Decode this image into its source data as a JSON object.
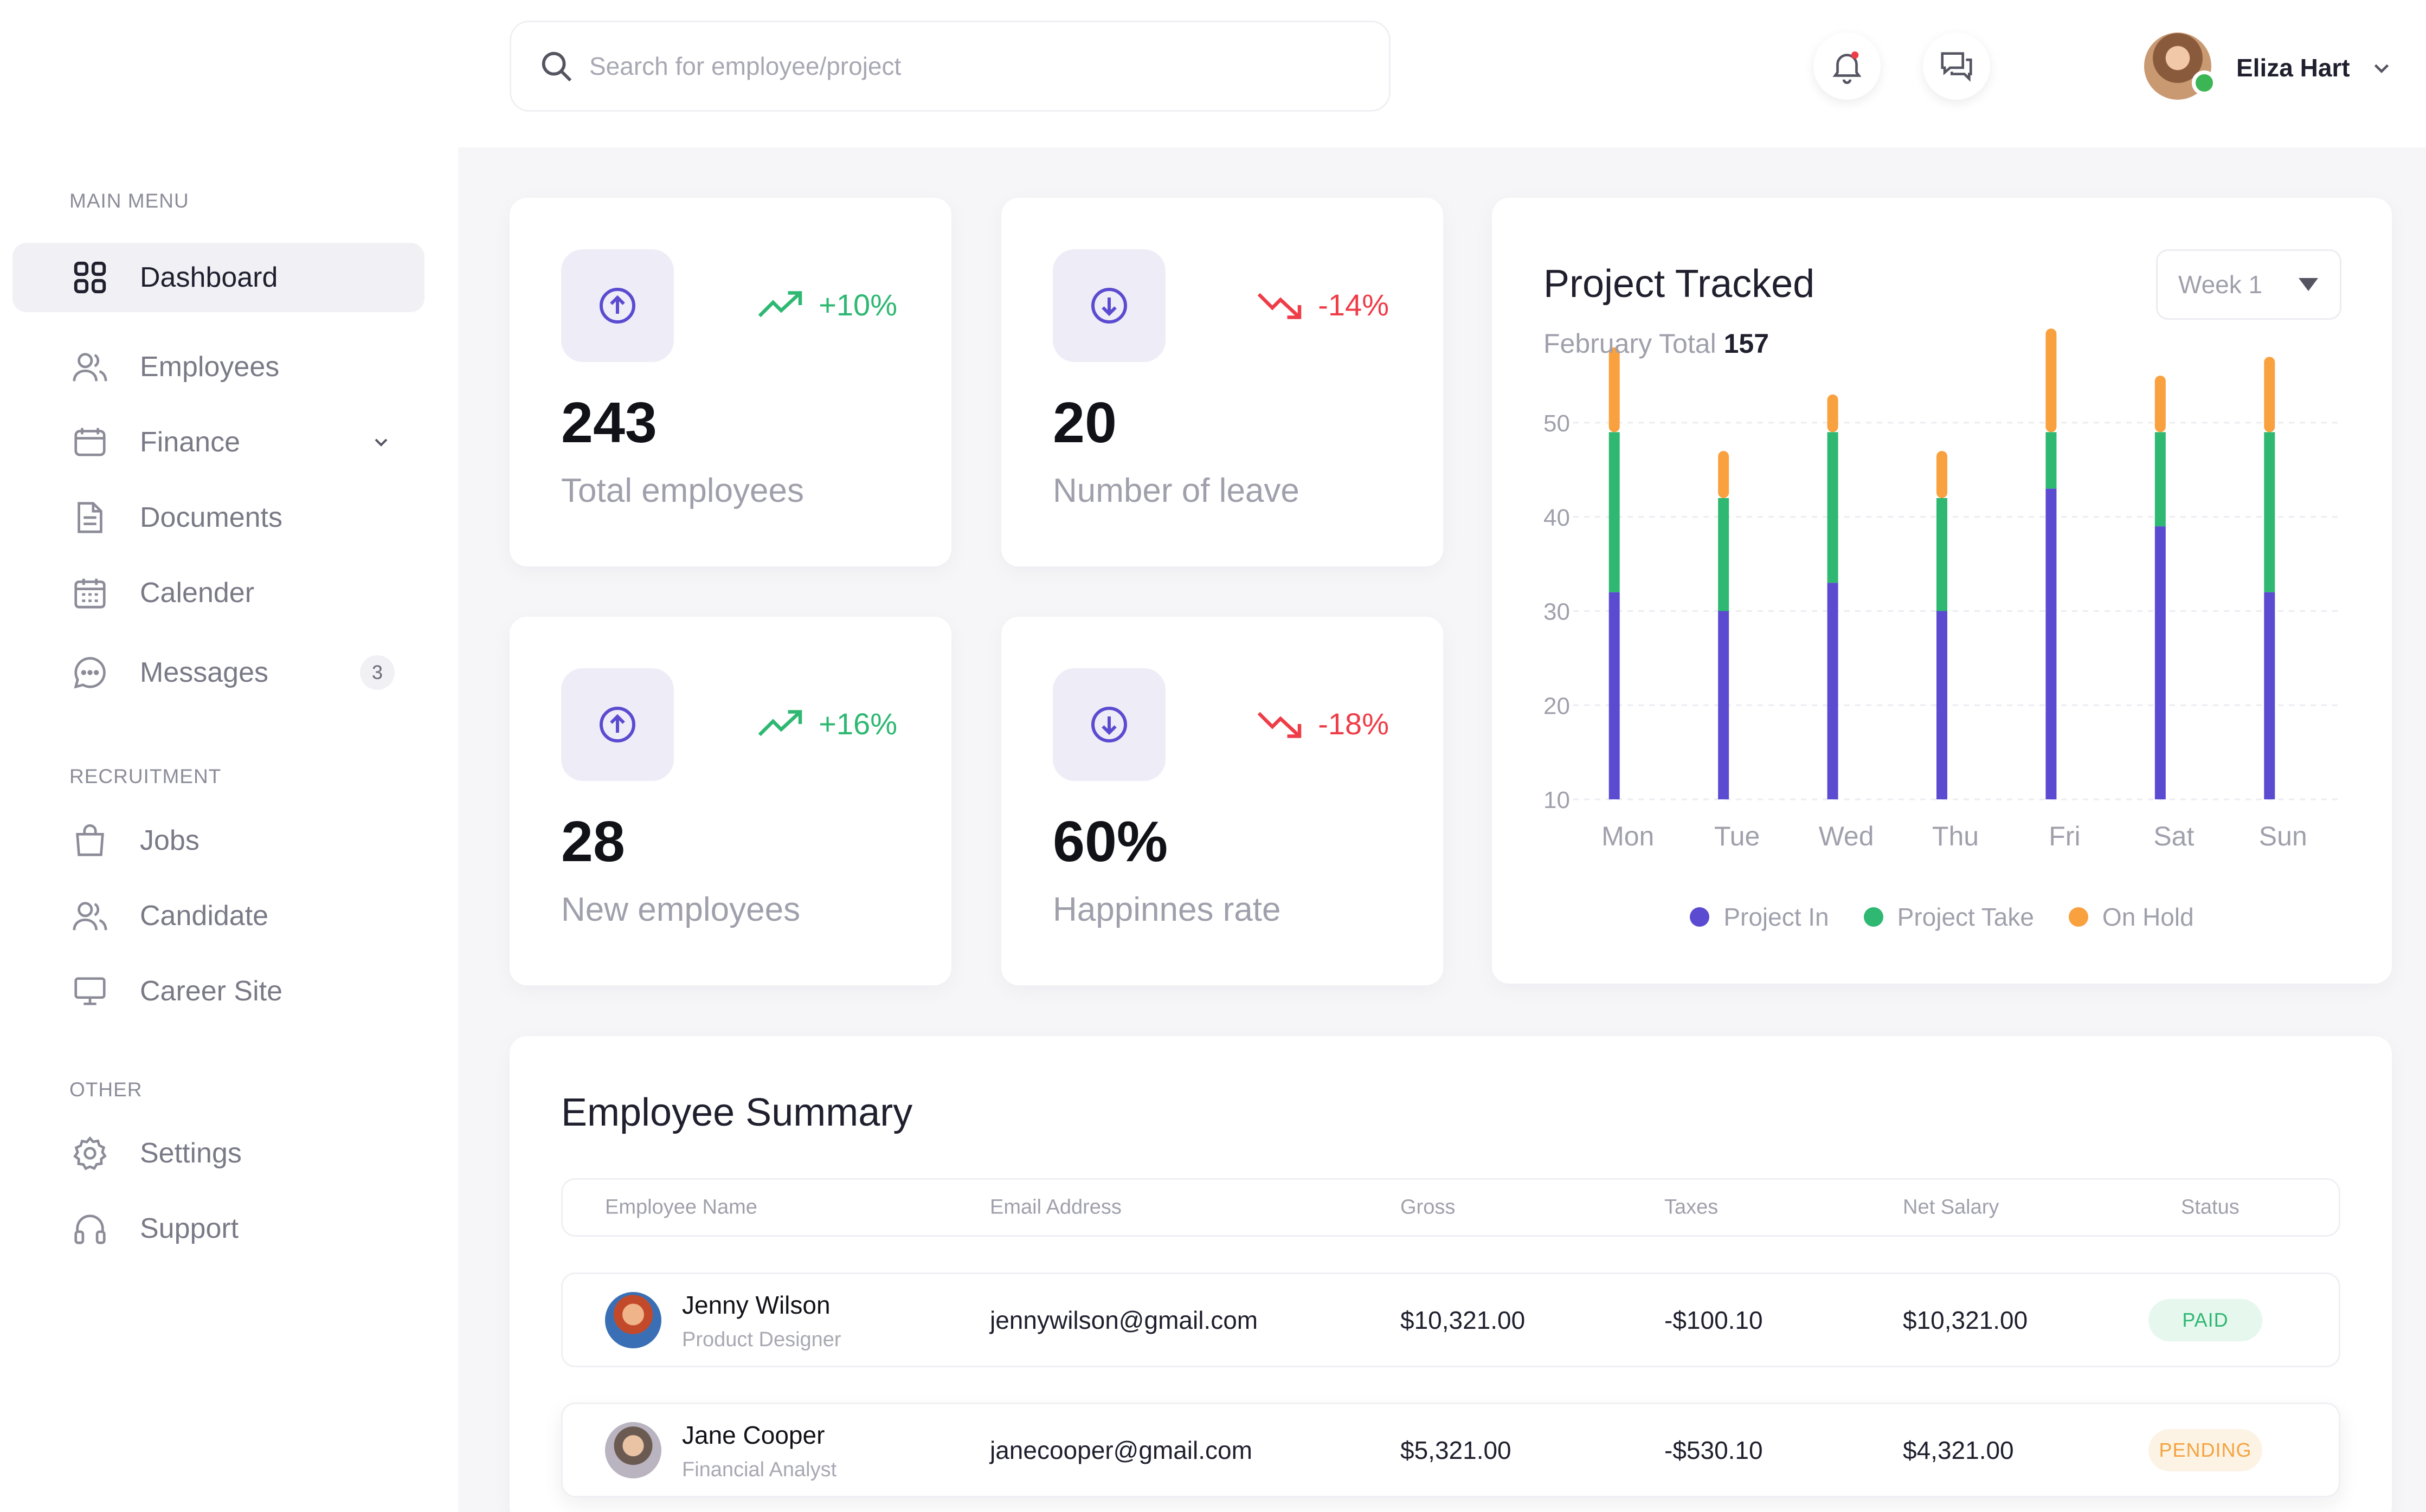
{
  "search": {
    "placeholder": "Search for employee/project"
  },
  "user": {
    "name": "Eliza Hart"
  },
  "sidebar": {
    "sections": {
      "main": "MAIN MENU",
      "recruitment": "RECRUITMENT",
      "other": "OTHER"
    },
    "items": [
      {
        "label": "Dashboard",
        "icon": "grid-icon",
        "active": true
      },
      {
        "label": "Employees",
        "icon": "users-icon"
      },
      {
        "label": "Finance",
        "icon": "wallet-icon",
        "has_chevron": true
      },
      {
        "label": "Documents",
        "icon": "document-icon"
      },
      {
        "label": "Calender",
        "icon": "calendar-icon"
      },
      {
        "label": "Messages",
        "icon": "chat-icon",
        "badge": "3"
      },
      {
        "label": "Jobs",
        "icon": "bag-icon"
      },
      {
        "label": "Candidate",
        "icon": "users-icon"
      },
      {
        "label": "Career Site",
        "icon": "monitor-icon"
      },
      {
        "label": "Settings",
        "icon": "gear-icon"
      },
      {
        "label": "Support",
        "icon": "headset-icon"
      }
    ]
  },
  "stats": [
    {
      "value": "243",
      "label": "Total employees",
      "trend": "+10%",
      "direction": "up"
    },
    {
      "value": "20",
      "label": "Number of leave",
      "trend": "-14%",
      "direction": "down"
    },
    {
      "value": "28",
      "label": "New employees",
      "trend": "+16%",
      "direction": "up"
    },
    {
      "value": "60%",
      "label": "Happinnes rate",
      "trend": "-18%",
      "direction": "down"
    }
  ],
  "project_chart": {
    "title": "Project Tracked",
    "subtitle_label": "February Total",
    "subtitle_value": "157",
    "week_select": "Week 1"
  },
  "chart_data": {
    "type": "bar",
    "stacked": true,
    "categories": [
      "Mon",
      "Tue",
      "Wed",
      "Thu",
      "Fri",
      "Sat",
      "Sun"
    ],
    "series": [
      {
        "name": "Project In",
        "color": "#5b4bd1",
        "values": [
          22,
          20,
          23,
          20,
          33,
          29,
          22
        ]
      },
      {
        "name": "Project Take",
        "color": "#2eb872",
        "values": [
          17,
          12,
          16,
          12,
          6,
          10,
          17
        ]
      },
      {
        "name": "On Hold",
        "color": "#f9a03f",
        "values": [
          9,
          5,
          4,
          5,
          11,
          6,
          8
        ]
      }
    ],
    "yticks": [
      10,
      20,
      30,
      40,
      50
    ],
    "ylim": [
      10,
      50
    ],
    "grid": true,
    "legend_position": "bottom"
  },
  "summary": {
    "title": "Employee Summary",
    "columns": [
      "Employee Name",
      "Email Address",
      "Gross",
      "Taxes",
      "Net Salary",
      "Status"
    ],
    "rows": [
      {
        "name": "Jenny Wilson",
        "role": "Product Designer",
        "email": "jennywilson@gmail.com",
        "gross": "$10,321.00",
        "taxes": "-$100.10",
        "net": "$10,321.00",
        "status": "PAID"
      },
      {
        "name": "Jane Cooper",
        "role": "Financial Analyst",
        "email": "janecooper@gmail.com",
        "gross": "$5,321.00",
        "taxes": "-$530.10",
        "net": "$4,321.00",
        "status": "PENDING"
      }
    ]
  },
  "colors": {
    "accent": "#5b4bd1",
    "up": "#2eb872",
    "down": "#ee3d48",
    "on_hold": "#f9a03f"
  }
}
